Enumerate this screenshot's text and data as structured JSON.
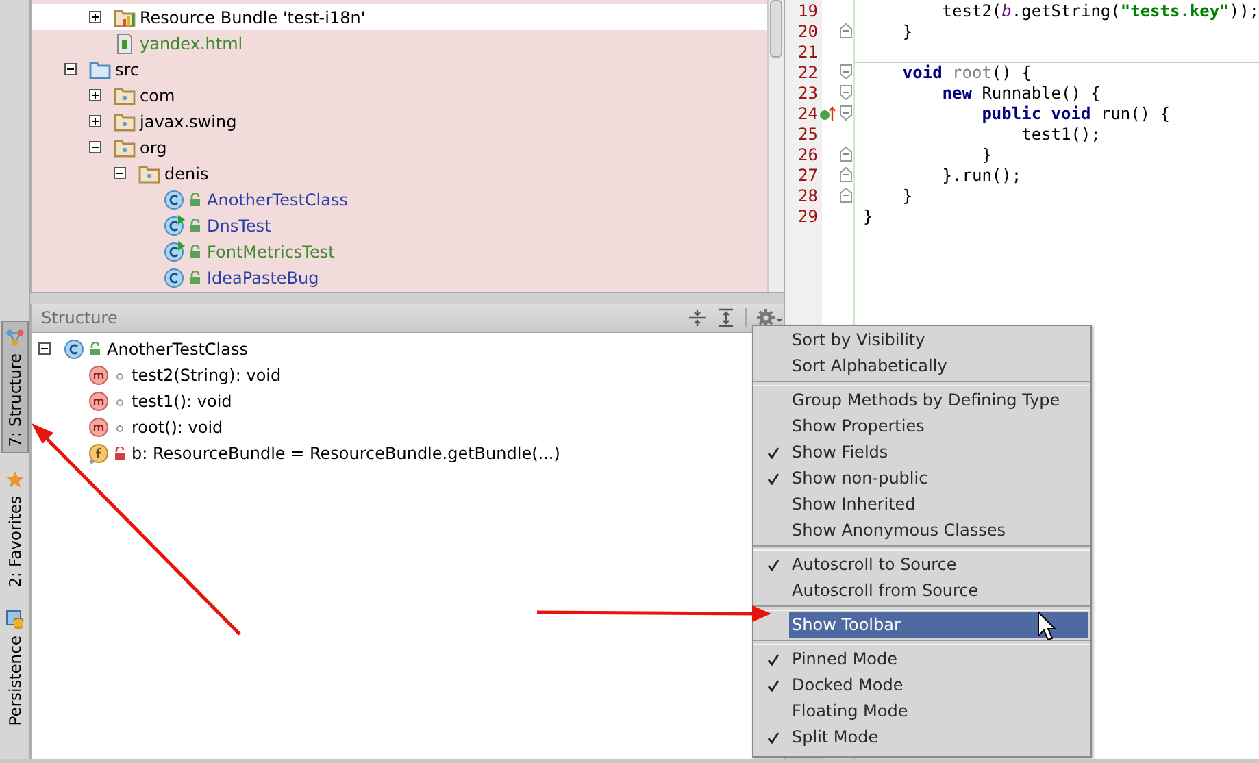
{
  "tool_strip": {
    "tabs": [
      {
        "label": "7: Structure",
        "selected": true,
        "kind": "structure"
      },
      {
        "label": "2: Favorites",
        "selected": false,
        "kind": "star"
      },
      {
        "label": "Persistence",
        "selected": false,
        "kind": "persistence"
      }
    ]
  },
  "project_tree": {
    "items": [
      {
        "children": [
          {
            "label": "Resource Bundle 'test-i18n'",
            "kind": "bundle",
            "expanded": false,
            "selected": true,
            "color": "#000000"
          },
          {
            "label": "yandex.html",
            "kind": "html",
            "selected": false,
            "color": "#3c8a2e"
          }
        ]
      },
      {
        "label": "src",
        "kind": "source",
        "expanded": true,
        "selected": false,
        "color": "#000000",
        "children": [
          {
            "label": "com",
            "kind": "package",
            "expanded": false,
            "selected": false,
            "color": "#000000"
          },
          {
            "label": "javax.swing",
            "kind": "package",
            "expanded": false,
            "selected": false,
            "color": "#000000"
          },
          {
            "label": "org",
            "kind": "package",
            "expanded": true,
            "selected": false,
            "color": "#000000",
            "children": [
              {
                "label": "denis",
                "kind": "package",
                "expanded": true,
                "selected": false,
                "color": "#000000",
                "children": [
                  {
                    "label": "AnotherTestClass",
                    "kind": "class",
                    "selected": false,
                    "color": "#2a3fa8"
                  },
                  {
                    "label": "DnsTest",
                    "kind": "runnable",
                    "selected": false,
                    "color": "#2a3fa8"
                  },
                  {
                    "label": "FontMetricsTest",
                    "kind": "runnable",
                    "selected": false,
                    "color": "#3c8a2e"
                  },
                  {
                    "label": "IdeaPasteBug",
                    "kind": "class",
                    "selected": false,
                    "color": "#2a3fa8"
                  }
                ]
              }
            ]
          }
        ]
      }
    ]
  },
  "editor": {
    "lines": [
      {
        "number": "19",
        "tokens": [
          {
            "kind": "plain",
            "text": "        test2("
          },
          {
            "kind": "field",
            "text": "b"
          },
          {
            "kind": "plain",
            "text": ".getString("
          },
          {
            "kind": "string",
            "text": "\"tests.key\""
          },
          {
            "kind": "plain",
            "text": "));"
          }
        ]
      },
      {
        "number": "20",
        "fold_end": true,
        "tokens": [
          {
            "kind": "plain",
            "text": "    }"
          }
        ]
      },
      {
        "number": "21"
      },
      {
        "number": "22",
        "foldable": true,
        "separator_above": true,
        "tokens": [
          {
            "kind": "keyword",
            "text": "    void"
          },
          {
            "kind": "unused",
            "text": " root"
          },
          {
            "kind": "plain",
            "text": "() {"
          }
        ]
      },
      {
        "number": "23",
        "foldable": true,
        "tokens": [
          {
            "kind": "keyword",
            "text": "        new"
          },
          {
            "kind": "plain",
            "text": " Runnable() {"
          }
        ]
      },
      {
        "number": "24",
        "foldable": true,
        "implements": true,
        "tokens": [
          {
            "kind": "keyword",
            "text": "            public void"
          },
          {
            "kind": "plain",
            "text": " run() {"
          }
        ]
      },
      {
        "number": "25",
        "tokens": [
          {
            "kind": "plain",
            "text": "                test1();"
          }
        ]
      },
      {
        "number": "26",
        "fold_end": true,
        "tokens": [
          {
            "kind": "plain",
            "text": "            }"
          }
        ]
      },
      {
        "number": "27",
        "fold_end": true,
        "tokens": [
          {
            "kind": "plain",
            "text": "        }.run();"
          }
        ]
      },
      {
        "number": "28",
        "fold_end": true,
        "tokens": [
          {
            "kind": "plain",
            "text": "    }"
          }
        ]
      },
      {
        "number": "29",
        "tokens": [
          {
            "kind": "plain",
            "text": "}"
          }
        ]
      }
    ]
  },
  "structure": {
    "title": "Structure",
    "items": [
      {
        "label": "AnotherTestClass",
        "kind": "class",
        "expanded": true,
        "selected": false,
        "children": [
          {
            "label": "test2(String): void",
            "kind": "method",
            "selected": false
          },
          {
            "label": "test1(): void",
            "kind": "method",
            "selected": false
          },
          {
            "label": "root(): void",
            "kind": "method",
            "selected": false
          },
          {
            "label": "b: ResourceBundle = ResourceBundle.getBundle(...)",
            "kind": "field",
            "selected": false
          }
        ]
      }
    ]
  },
  "menu": {
    "groups": [
      {
        "items": [
          {
            "label": "Sort by Visibility",
            "checked": false,
            "selected": false
          },
          {
            "label": "Sort Alphabetically",
            "checked": false,
            "selected": false
          }
        ]
      },
      {
        "items": [
          {
            "label": "Group Methods by Defining Type",
            "checked": false,
            "selected": false
          },
          {
            "label": "Show Properties",
            "checked": false,
            "selected": false
          },
          {
            "label": "Show Fields",
            "checked": true,
            "selected": false
          },
          {
            "label": "Show non-public",
            "checked": true,
            "selected": false
          },
          {
            "label": "Show Inherited",
            "checked": false,
            "selected": false
          },
          {
            "label": "Show Anonymous Classes",
            "checked": false,
            "selected": false
          }
        ]
      },
      {
        "items": [
          {
            "label": "Autoscroll to Source",
            "checked": true,
            "selected": false
          },
          {
            "label": "Autoscroll from Source",
            "checked": false,
            "selected": false
          }
        ]
      },
      {
        "items": [
          {
            "label": "Show Toolbar",
            "checked": false,
            "selected": true
          }
        ]
      },
      {
        "items": [
          {
            "label": "Pinned Mode",
            "checked": true,
            "selected": false
          },
          {
            "label": "Docked Mode",
            "checked": true,
            "selected": false
          },
          {
            "label": "Floating Mode",
            "checked": false,
            "selected": false
          },
          {
            "label": "Split Mode",
            "checked": true,
            "selected": false
          }
        ]
      }
    ]
  }
}
